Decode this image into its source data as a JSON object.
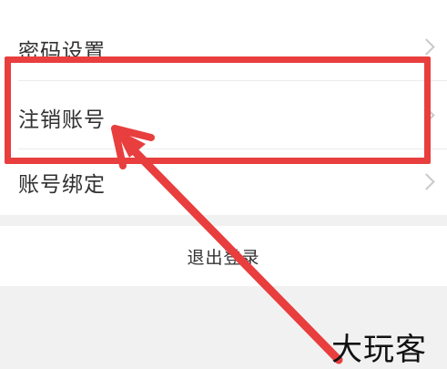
{
  "settings": {
    "items": [
      {
        "label": "密码设置"
      },
      {
        "label": "注销账号"
      },
      {
        "label": "账号绑定"
      }
    ]
  },
  "logout": {
    "label": "退出登录"
  },
  "annotation": {
    "highlight_color": "#e83e3e",
    "arrow_color": "#e83e3e"
  },
  "watermark": {
    "text": "大玩客"
  },
  "icons": {
    "row_chevron": "chevron-right-icon"
  }
}
